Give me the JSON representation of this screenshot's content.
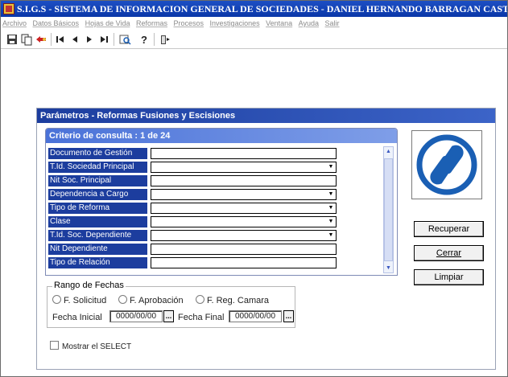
{
  "window": {
    "title": "S.I.G.S  - SISTEMA DE INFORMACION GENERAL DE SOCIEDADES - DANIEL HERNANDO BARRAGAN CASTRO"
  },
  "menu": [
    "Archivo",
    "Datos Básicos",
    "Hojas de Vida",
    "Reformas",
    "Procesos",
    "Investigaciones",
    "Ventana",
    "Ayuda",
    "Salir"
  ],
  "panel": {
    "title": "Parámetros -  Reformas Fusiones y Escisiones",
    "criteria_header": "Criterio de consulta : 1  de  24",
    "fields": [
      {
        "label": "Documento de Gestión",
        "value": "",
        "dropdown": false
      },
      {
        "label": "T.Id. Sociedad Principal",
        "value": "",
        "dropdown": true
      },
      {
        "label": "Nit Soc. Principal",
        "value": "",
        "dropdown": false
      },
      {
        "label": "Dependencia a Cargo",
        "value": "",
        "dropdown": true
      },
      {
        "label": "Tipo de Reforma",
        "value": "",
        "dropdown": true
      },
      {
        "label": "Clase",
        "value": "",
        "dropdown": true
      },
      {
        "label": "T.Id. Soc. Dependiente",
        "value": "",
        "dropdown": true
      },
      {
        "label": "Nit Dependiente",
        "value": "",
        "dropdown": false
      },
      {
        "label": "Tipo de Relación",
        "value": "",
        "dropdown": false
      }
    ],
    "buttons": {
      "recuperar": "Recuperar",
      "cerrar": "Cerrar",
      "limpiar": "Limpiar"
    },
    "date_range": {
      "legend": "Rango de Fechas",
      "options": [
        "F. Solicitud",
        "F. Aprobación",
        "F. Reg. Camara"
      ],
      "start_label": "Fecha Inicial",
      "start_value": "0000/00/00",
      "end_label": "Fecha Final",
      "end_value": "0000/00/00",
      "picker_label": "..."
    },
    "show_select": "Mostrar el SELECT"
  },
  "colors": {
    "title_bar": "#0a37a8",
    "label_bg": "#1c3d9e",
    "criteria_header": "#4a72d8",
    "logo_blue": "#1a5fb4"
  }
}
